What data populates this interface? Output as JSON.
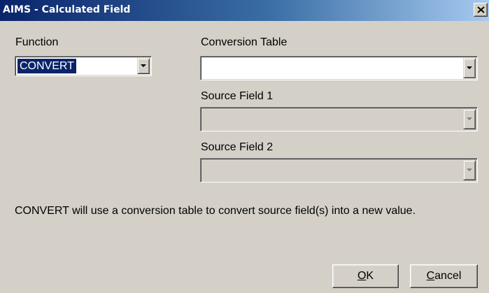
{
  "window": {
    "title": "AIMS - Calculated Field",
    "close_icon": "close-icon"
  },
  "function": {
    "label": "Function",
    "selected": "CONVERT",
    "enabled": true
  },
  "conversion_table": {
    "label": "Conversion Table",
    "value": "",
    "enabled": true
  },
  "source_field_1": {
    "label": "Source Field 1",
    "value": "",
    "enabled": false
  },
  "source_field_2": {
    "label": "Source Field 2",
    "value": "",
    "enabled": false
  },
  "description": "CONVERT will use a conversion table to convert source field(s) into a new value.",
  "buttons": {
    "ok": {
      "mnemonic": "O",
      "rest": "K"
    },
    "cancel": {
      "mnemonic": "C",
      "rest": "ancel"
    }
  },
  "colors": {
    "title_bar_start": "#0a246a",
    "title_bar_end": "#a6caf0",
    "dialog_face": "#d4d0c8",
    "selection": "#0a246a"
  }
}
